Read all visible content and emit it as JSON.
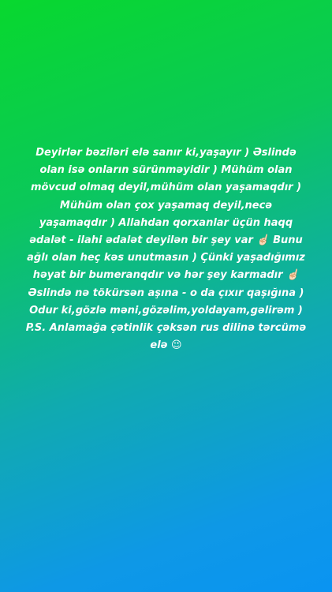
{
  "story": {
    "background_colors": [
      "#08d82e",
      "#0bc85a",
      "#10aab0",
      "#0e98e6",
      "#0a94f2"
    ],
    "text_color": "#ffffff",
    "lines": [
      "Deyirlər bəziləri elə sanır ki,yaşayır ) Əslində",
      "olan isə onların sürünməyidir ) Mühüm olan",
      "mövcud olmaq deyil,mühüm olan yaşamaqdır )",
      "Mühüm olan çox yaşamaq deyil,necə",
      "yaşamaqdır ) Allahdan qorxanlar üçün haqq",
      "ədalət - ilahi ədalət deyilən bir şey var ☝🏻 Bunu",
      "ağlı olan heç kəs unutmasın ) Çünki yaşadığımız",
      "həyat bir bumeranqdır və hər şey karmadır ☝🏻",
      "Əslində nə tökürsən aşına - o da çıxır qaşığına )",
      "Odur ki,gözlə məni,gözəlim,yoldayam,gəlirəm )",
      "P.S. Anlamağa çətinlik çəksən rus dilinə tərcümə",
      "elə 😉"
    ]
  }
}
